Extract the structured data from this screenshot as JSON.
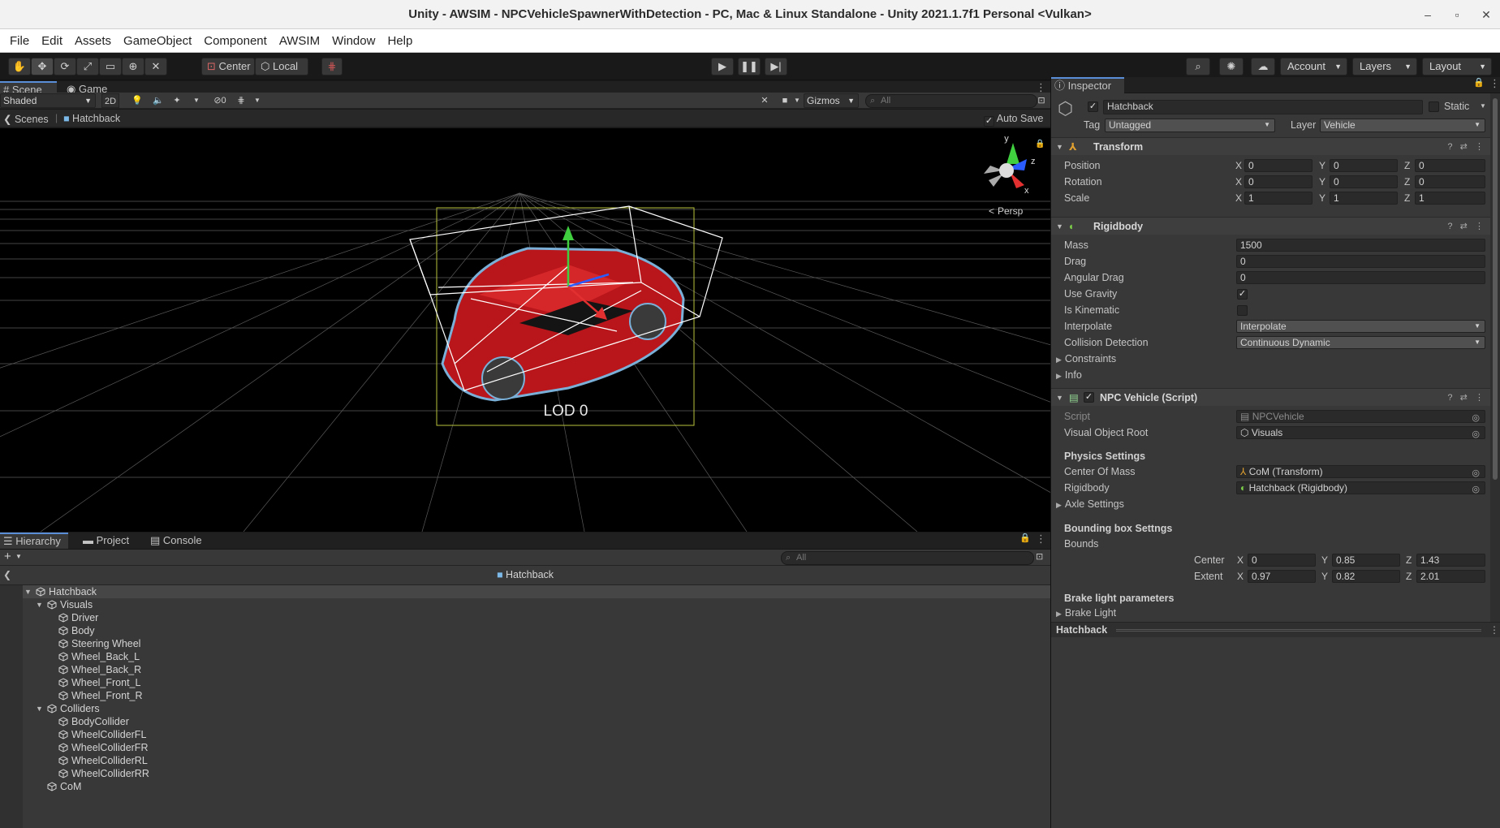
{
  "window": {
    "title": "Unity - AWSIM - NPCVehicleSpawnerWithDetection - PC, Mac & Linux Standalone - Unity 2021.1.7f1 Personal <Vulkan>",
    "controls": [
      "–",
      "▫",
      "✕"
    ]
  },
  "menu": [
    "File",
    "Edit",
    "Assets",
    "GameObject",
    "Component",
    "AWSIM",
    "Window",
    "Help"
  ],
  "toolbar": {
    "pivot_label": "Center",
    "space_label": "Local",
    "account_label": "Account",
    "layers_label": "Layers",
    "layout_label": "Layout"
  },
  "scene": {
    "tabs": [
      "Scene",
      "Game"
    ],
    "shading_mode": "Shaded",
    "mode_2d": "2D",
    "hidden_count": "0",
    "gizmos_label": "Gizmos",
    "search_placeholder": "All",
    "breadcrumb_root": "Scenes",
    "breadcrumb_current": "Hatchback",
    "auto_save_label": "Auto Save",
    "auto_save_checked": true,
    "lod_label": "LOD 0",
    "persp_label": "Persp",
    "gizmo_axes": {
      "y": "y",
      "z": "z",
      "x": "x"
    }
  },
  "hierarchy": {
    "tabs": [
      "Hierarchy",
      "Project",
      "Console"
    ],
    "search_placeholder": "All",
    "prefab_title": "Hatchback",
    "items": [
      {
        "label": "Hatchback",
        "depth": 0,
        "expanded": true
      },
      {
        "label": "Visuals",
        "depth": 1,
        "expanded": true
      },
      {
        "label": "Driver",
        "depth": 2
      },
      {
        "label": "Body",
        "depth": 2
      },
      {
        "label": "Steering Wheel",
        "depth": 2
      },
      {
        "label": "Wheel_Back_L",
        "depth": 2
      },
      {
        "label": "Wheel_Back_R",
        "depth": 2
      },
      {
        "label": "Wheel_Front_L",
        "depth": 2
      },
      {
        "label": "Wheel_Front_R",
        "depth": 2
      },
      {
        "label": "Colliders",
        "depth": 1,
        "expanded": true
      },
      {
        "label": "BodyCollider",
        "depth": 2
      },
      {
        "label": "WheelColliderFL",
        "depth": 2
      },
      {
        "label": "WheelColliderFR",
        "depth": 2
      },
      {
        "label": "WheelColliderRL",
        "depth": 2
      },
      {
        "label": "WheelColliderRR",
        "depth": 2
      },
      {
        "label": "CoM",
        "depth": 1
      }
    ]
  },
  "inspector": {
    "tab": "Inspector",
    "object_name": "Hatchback",
    "static_label": "Static",
    "tag_label": "Tag",
    "tag_value": "Untagged",
    "layer_label": "Layer",
    "layer_value": "Vehicle",
    "transform": {
      "title": "Transform",
      "position_label": "Position",
      "position": {
        "x": "0",
        "y": "0",
        "z": "0"
      },
      "rotation_label": "Rotation",
      "rotation": {
        "x": "0",
        "y": "0",
        "z": "0"
      },
      "scale_label": "Scale",
      "scale": {
        "x": "1",
        "y": "1",
        "z": "1"
      }
    },
    "rigidbody": {
      "title": "Rigidbody",
      "mass_label": "Mass",
      "mass": "1500",
      "drag_label": "Drag",
      "drag": "0",
      "angular_drag_label": "Angular Drag",
      "angular_drag": "0",
      "use_gravity_label": "Use Gravity",
      "use_gravity": true,
      "is_kinematic_label": "Is Kinematic",
      "is_kinematic": false,
      "interpolate_label": "Interpolate",
      "interpolate": "Interpolate",
      "collision_label": "Collision Detection",
      "collision": "Continuous Dynamic",
      "constraints_label": "Constraints",
      "info_label": "Info"
    },
    "npc_vehicle": {
      "title": "NPC Vehicle (Script)",
      "script_label": "Script",
      "script": "NPCVehicle",
      "visual_root_label": "Visual Object Root",
      "visual_root": "Visuals",
      "physics_heading": "Physics Settings",
      "com_label": "Center Of Mass",
      "com": "CoM (Transform)",
      "rigidbody_label": "Rigidbody",
      "rigidbody": "Hatchback (Rigidbody)",
      "axle_label": "Axle Settings",
      "bbox_heading": "Bounding box Settngs",
      "bounds_label": "Bounds",
      "center_label": "Center",
      "center": {
        "x": "0",
        "y": "0.85",
        "z": "1.43"
      },
      "extent_label": "Extent",
      "extent": {
        "x": "0.97",
        "y": "0.82",
        "z": "2.01"
      },
      "brake_heading": "Brake light parameters",
      "brake_label": "Brake Light"
    },
    "footer_label": "Hatchback"
  },
  "colors": {
    "accent": "#5a8fd8",
    "vehicle_red": "#c0161a",
    "bounds_yellow": "#b8c23a"
  }
}
